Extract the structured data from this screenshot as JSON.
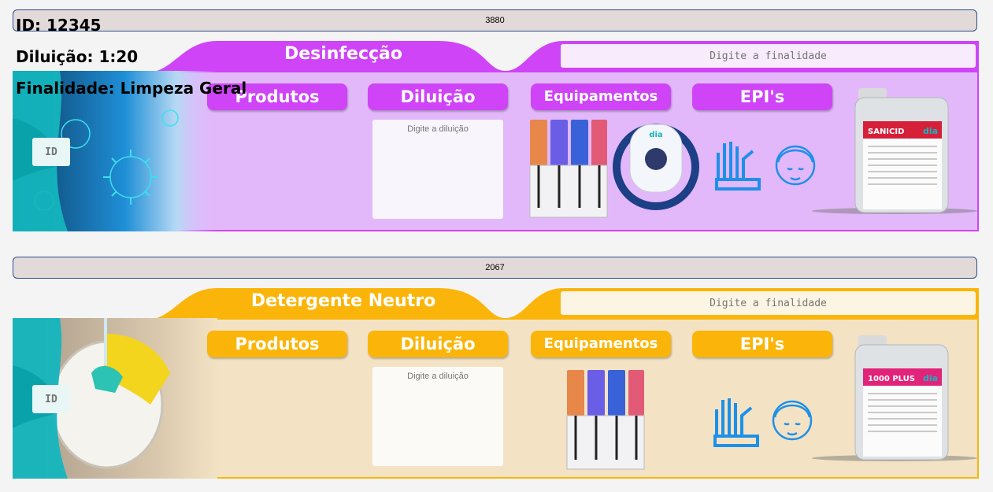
{
  "overlay": {
    "id_line": "ID: 12345",
    "diluicao_line": "Diluição: 1:20",
    "finalidade_line": "Finalidade: Limpeza Geral"
  },
  "colors": {
    "purple_accent": "#cf44f7",
    "purple_body": "#e2b8fb",
    "orange_accent": "#fbb50a",
    "orange_body": "#f3e3c4",
    "teal": "#14b5be",
    "icon_blue": "#1e90e8"
  },
  "labels": [
    {
      "code": "3880",
      "title": "Desinfecção",
      "finalidade_placeholder": "Digite a finalidade",
      "id_placeholder": "ID",
      "diluicao_placeholder": "Digite a diluição",
      "headers": {
        "produtos": "Produtos",
        "diluicao": "Diluição",
        "equipamentos": "Equipamentos",
        "epis": "EPI's"
      },
      "product_name": "SANICID",
      "brand": "dia",
      "photo": "virus-illustration"
    },
    {
      "code": "2067",
      "title": "Detergente  Neutro",
      "finalidade_placeholder": "Digite a finalidade",
      "id_placeholder": "ID",
      "diluicao_placeholder": "Digite a diluição",
      "headers": {
        "produtos": "Produtos",
        "diluicao": "Diluição",
        "equipamentos": "Equipamentos",
        "epis": "EPI's"
      },
      "product_name": "1000 PLUS",
      "brand": "dia",
      "photo": "dishwashing-photo"
    }
  ]
}
